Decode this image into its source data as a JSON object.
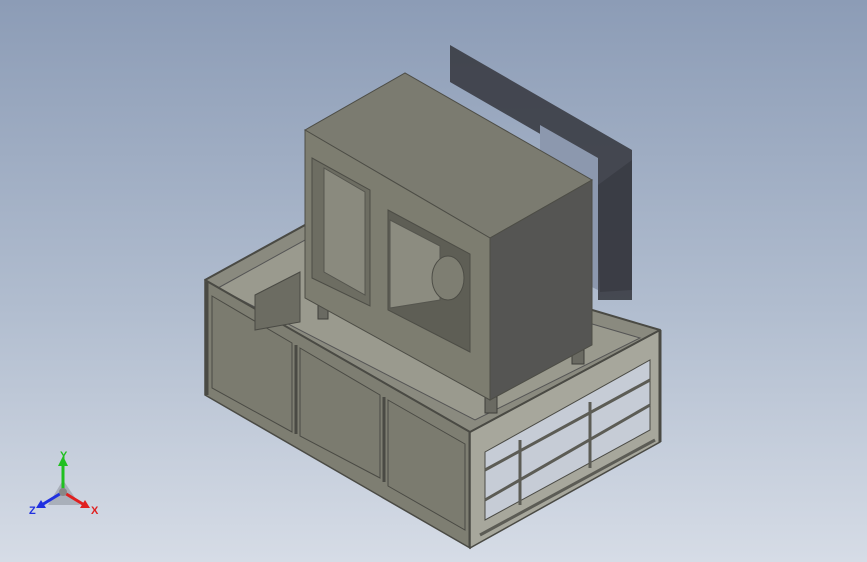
{
  "viewport": {
    "background_top": "#8c9cb6",
    "background_bottom": "#d6dce6"
  },
  "model": {
    "name": "",
    "colors": {
      "housing_front": "#7d7d70",
      "housing_top": "#7b7b70",
      "housing_side": "#555553",
      "frame_panel": "#7e7e72",
      "frame_edge": "#4a4a44",
      "shadow": "#3a3c44"
    }
  },
  "triad": {
    "x_label": "X",
    "y_label": "Y",
    "z_label": "Z",
    "x_color": "#e02020",
    "y_color": "#20c020",
    "z_color": "#2030e0"
  }
}
